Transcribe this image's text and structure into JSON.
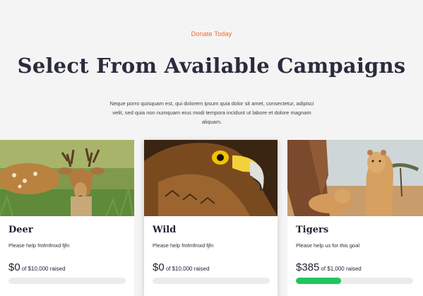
{
  "header": {
    "eyebrow": "Donate Today",
    "title": "Select From Available Campaigns",
    "description": "Neque porro quisquam est, qui dolorem ipsum quia dolor sit amet, consectetur, adipisci velit, sed quia non numquam eius modi tempora incidunt ut labore et dolore magnam aliquam."
  },
  "colors": {
    "accent": "#f0642a",
    "progress": "#21c55d",
    "title": "#2a2c3d"
  },
  "campaigns": [
    {
      "title": "Deer",
      "text": "Please help fmfmfmxd fjfn",
      "amount": "$0",
      "goal_text": "of $10,000 raised",
      "progress": 0,
      "image": "deer-photo"
    },
    {
      "title": "Wild",
      "text": "Please help fmfmfmxd fjfn",
      "amount": "$0",
      "goal_text": "of $10,000 raised",
      "progress": 0,
      "image": "eagle-photo"
    },
    {
      "title": "Tigers",
      "text": "Please help us for this goal",
      "amount": "$385",
      "goal_text": "of $1,000 raised",
      "progress": 0.385,
      "image": "lions-photo"
    }
  ]
}
